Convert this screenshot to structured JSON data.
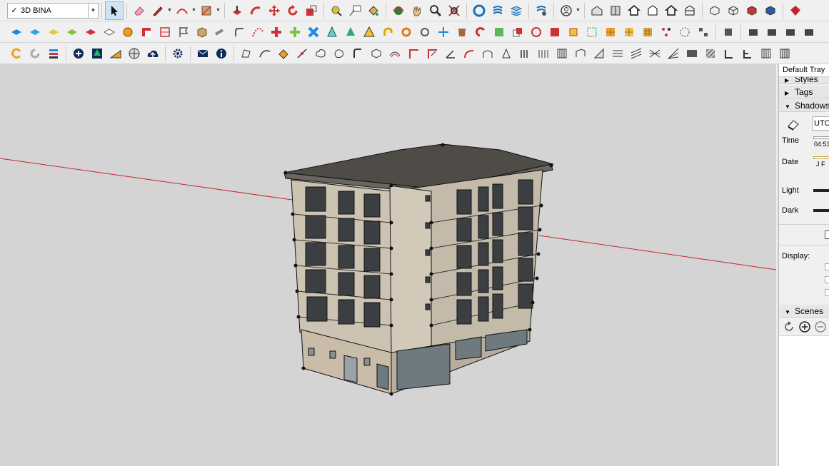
{
  "toolbar": {
    "tag_dropdown": {
      "checked_mark": "✓",
      "value": "3D BINA"
    }
  },
  "tray": {
    "title": "Default Tray",
    "panels": {
      "styles": "Styles",
      "tags": "Tags",
      "shadows": "Shadows",
      "scenes": "Scenes"
    },
    "shadows": {
      "timezone": "UTC",
      "time_label": "Time",
      "time_value": "04:53",
      "date_label": "Date",
      "date_value": "J F",
      "light_label": "Light",
      "dark_label": "Dark",
      "display_label": "Display:"
    }
  },
  "colors": {
    "viewport_bg": "#d4d4d4",
    "red_axis": "#c8242b",
    "building_wall": "#cdc3b3",
    "roof": "#4f4c48",
    "glass": "#6f7980"
  }
}
